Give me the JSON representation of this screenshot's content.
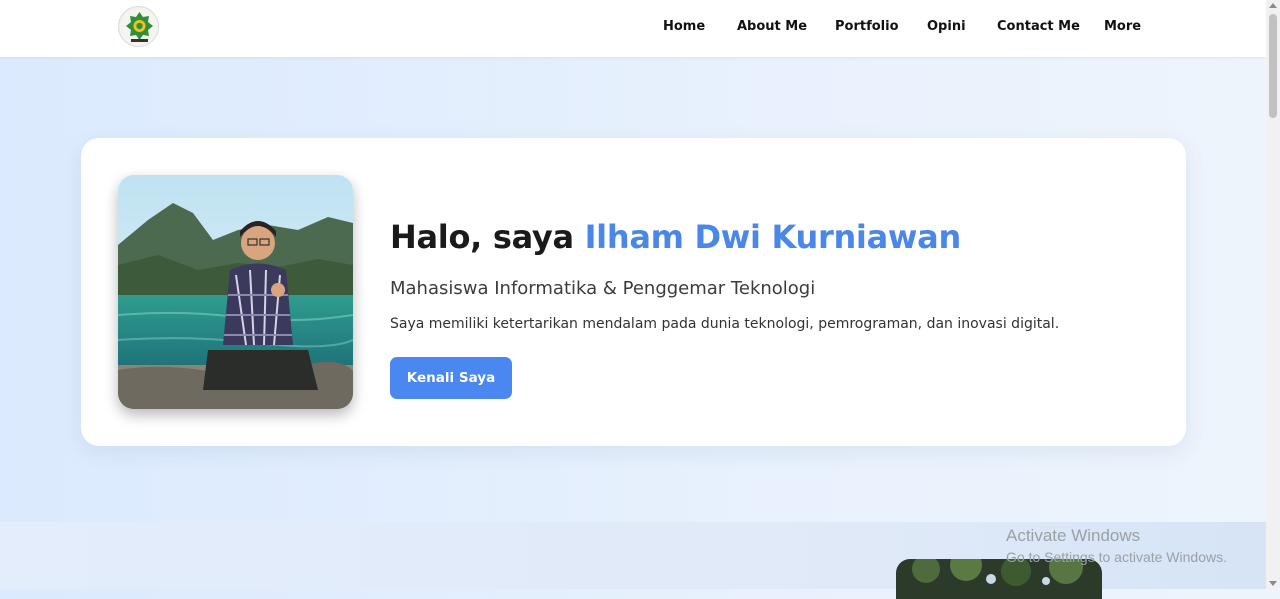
{
  "nav": {
    "logo_icon": "university-logo-icon",
    "links": [
      {
        "label": "Home"
      },
      {
        "label": "About Me"
      },
      {
        "label": "Portfolio"
      },
      {
        "label": "Opini"
      },
      {
        "label": "Contact Me"
      },
      {
        "label": "More"
      }
    ]
  },
  "hero": {
    "greeting": "Halo, saya ",
    "name": "Ilham Dwi Kurniawan",
    "subtitle": "Mahasiswa Informatika & Penggemar Teknologi",
    "description": "Saya memiliki ketertarikan mendalam pada dunia teknologi, pemrograman, dan inovasi digital.",
    "cta_label": "Kenali Saya",
    "photo_icon": "profile-photo"
  },
  "watermark": {
    "title": "Activate Windows",
    "subtitle": "Go to Settings to activate Windows."
  },
  "colors": {
    "accent": "#4a87f0",
    "name_highlight": "#4a87e8",
    "background": "#dbeafe"
  }
}
